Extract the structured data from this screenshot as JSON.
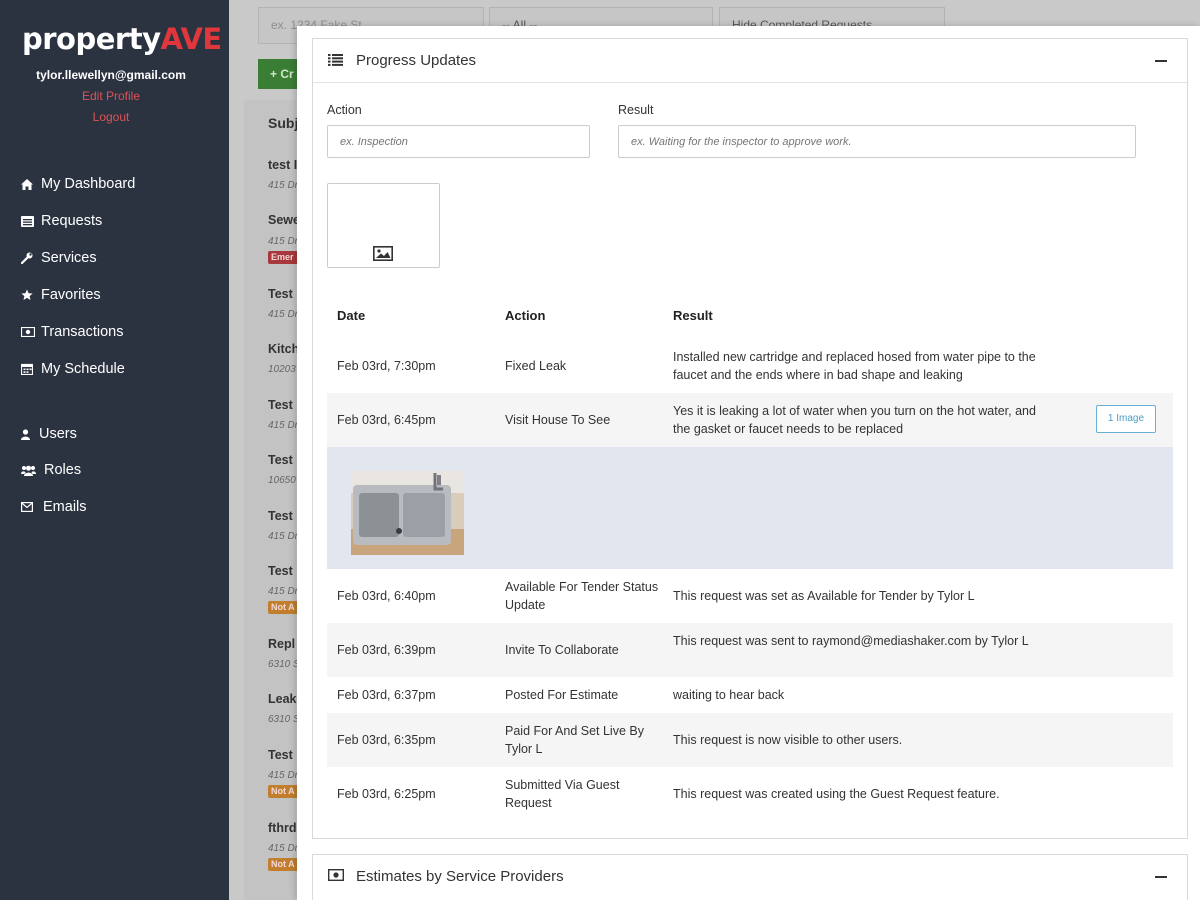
{
  "sidebar": {
    "logo": {
      "prefix": "property",
      "accent": "AVE"
    },
    "user_email": "tylor.llewellyn@gmail.com",
    "edit_profile": "Edit Profile",
    "logout": "Logout",
    "items": [
      {
        "label": "My Dashboard",
        "icon": "home-icon"
      },
      {
        "label": "Requests",
        "icon": "list-icon"
      },
      {
        "label": "Services",
        "icon": "wrench-icon"
      },
      {
        "label": "Favorites",
        "icon": "star-icon"
      },
      {
        "label": "Transactions",
        "icon": "money-icon"
      },
      {
        "label": "My Schedule",
        "icon": "calendar-icon"
      },
      {
        "label": "Users",
        "icon": "user-icon"
      },
      {
        "label": "Roles",
        "icon": "users-icon"
      },
      {
        "label": "Emails",
        "icon": "envelope-icon"
      }
    ],
    "accent_color": "#e0373c",
    "background_color": "#2b3240"
  },
  "background_list": {
    "search_placeholder": "ex. 1234 Fake St",
    "filter_value": "-- All --",
    "completed_filter_value": "Hide Completed Requests",
    "create_label": "+ Cr",
    "column_header": "Subj",
    "items": [
      {
        "title": "test I",
        "sub": "415 Dr"
      },
      {
        "title": "Sewe",
        "sub": "415 Dr",
        "badge": "Emer"
      },
      {
        "title": "Test",
        "sub": "415 Dr"
      },
      {
        "title": "Kitch",
        "sub": "10203"
      },
      {
        "title": "Test",
        "sub": "415 Dr"
      },
      {
        "title": "Test",
        "sub": "10650"
      },
      {
        "title": "Test",
        "sub": "415 Dr"
      },
      {
        "title": "Test",
        "sub": "415 Dr",
        "badge": "Not A"
      },
      {
        "title": "Repl",
        "sub": "6310 S"
      },
      {
        "title": "Leak",
        "sub": "6310 S"
      },
      {
        "title": "Test",
        "sub": "415 Dr",
        "badge": "Not A"
      },
      {
        "title": "fthrd",
        "sub": "415 Dr",
        "badge": "Not A"
      }
    ]
  },
  "progress_updates": {
    "title": "Progress Updates",
    "action_label": "Action",
    "action_placeholder": "ex. Inspection",
    "result_label": "Result",
    "result_placeholder": "ex. Waiting for the inspector to approve work.",
    "columns": {
      "date": "Date",
      "action": "Action",
      "result": "Result"
    },
    "rows": [
      {
        "date": "Feb 03rd, 7:30pm",
        "action": "Fixed Leak",
        "result": "Installed new cartridge and replaced hosed from water pipe to the faucet and the ends where in bad shape and leaking"
      },
      {
        "date": "Feb 03rd, 6:45pm",
        "action": "Visit House To See",
        "result": "Yes it is leaking a lot of water when you turn on the hot water, and the gasket or faucet needs to be replaced",
        "button": "1 Image"
      },
      {
        "date": "Feb 03rd, 6:40pm",
        "action": "Available For Tender Status Update",
        "result": "This request was set as Available for Tender by Tylor L"
      },
      {
        "date": "Feb 03rd, 6:39pm",
        "action": "Invite To Collaborate",
        "result": "This request was sent to raymond@mediashaker.com by Tylor L"
      },
      {
        "date": "Feb 03rd, 6:37pm",
        "action": "Posted For Estimate",
        "result": "waiting to hear back"
      },
      {
        "date": "Feb 03rd, 6:35pm",
        "action": "Paid For And Set Live By Tylor L",
        "result": "This request is now visible to other users."
      },
      {
        "date": "Feb 03rd, 6:25pm",
        "action": "Submitted Via Guest Request",
        "result": "This request was created using the Guest Request feature."
      }
    ]
  },
  "estimates": {
    "title": "Estimates by Service Providers"
  }
}
